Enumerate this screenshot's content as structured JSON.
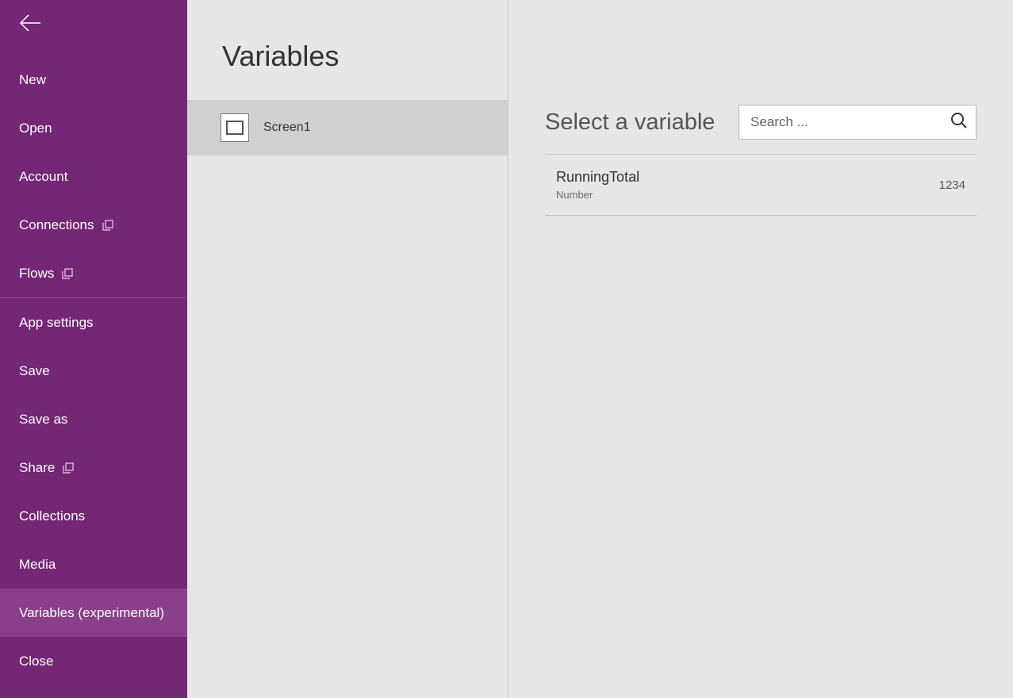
{
  "sidebar": {
    "items": [
      {
        "label": "New"
      },
      {
        "label": "Open"
      },
      {
        "label": "Account"
      },
      {
        "label": "Connections",
        "external": true
      },
      {
        "label": "Flows",
        "external": true
      },
      {
        "label": "App settings"
      },
      {
        "label": "Save"
      },
      {
        "label": "Save as"
      },
      {
        "label": "Share",
        "external": true
      },
      {
        "label": "Collections"
      },
      {
        "label": "Media"
      },
      {
        "label": "Variables (experimental)",
        "selected": true
      },
      {
        "label": "Close"
      }
    ]
  },
  "middle": {
    "title": "Variables",
    "screens": [
      {
        "label": "Screen1"
      }
    ]
  },
  "right": {
    "title": "Select a variable",
    "search_placeholder": "Search ...",
    "variables": [
      {
        "name": "RunningTotal",
        "type": "Number",
        "value": "1234"
      }
    ]
  }
}
